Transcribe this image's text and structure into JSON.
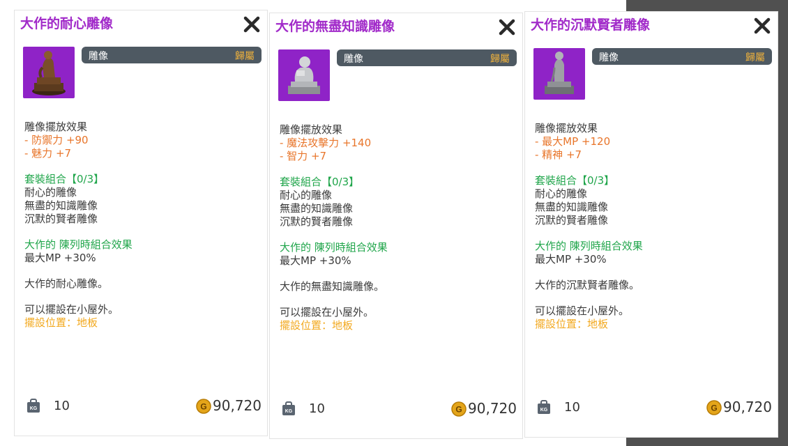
{
  "panels": [
    {
      "title": "大作的耐心雕像",
      "type_label": "雕像",
      "bind_label": "歸屬",
      "effect_heading": "雕像擺放效果",
      "stats": [
        "- 防禦力 +90",
        "- 魅力 +7"
      ],
      "set_heading": "套裝組合【0/3】",
      "set_items": [
        "耐心的雕像",
        "無盡的知識雕像",
        "沉默的賢者雕像"
      ],
      "combo_heading": "大作的 陳列時組合效果",
      "combo_effect": "最大MP +30%",
      "description": "大作的耐心雕像。",
      "placement_note": "可以擺設在小屋外。",
      "placement_location": "擺設位置：地板",
      "weight": "10",
      "price": "90,720",
      "thumb_bg": "#8f23c7"
    },
    {
      "title": "大作的無盡知識雕像",
      "type_label": "雕像",
      "bind_label": "歸屬",
      "effect_heading": "雕像擺放效果",
      "stats": [
        "- 魔法攻擊力 +140",
        "- 智力 +7"
      ],
      "set_heading": "套裝組合【0/3】",
      "set_items": [
        "耐心的雕像",
        "無盡的知識雕像",
        "沉默的賢者雕像"
      ],
      "combo_heading": "大作的 陳列時組合效果",
      "combo_effect": "最大MP +30%",
      "description": "大作的無盡知識雕像。",
      "placement_note": "可以擺設在小屋外。",
      "placement_location": "擺設位置：地板",
      "weight": "10",
      "price": "90,720",
      "thumb_bg": "#8f23c7"
    },
    {
      "title": "大作的沉默賢者雕像",
      "type_label": "雕像",
      "bind_label": "歸屬",
      "effect_heading": "雕像擺放效果",
      "stats": [
        "- 最大MP +120",
        "- 精神 +7"
      ],
      "set_heading": "套裝組合【0/3】",
      "set_items": [
        "耐心的雕像",
        "無盡的知識雕像",
        "沉默的賢者雕像"
      ],
      "combo_heading": "大作的 陳列時組合效果",
      "combo_effect": "最大MP +30%",
      "description": "大作的沉默賢者雕像。",
      "placement_note": "可以擺設在小屋外。",
      "placement_location": "擺設位置：地板",
      "weight": "10",
      "price": "90,720",
      "thumb_bg": "#8f23c7"
    }
  ],
  "icons": {
    "close": "close-icon",
    "weight": "kg-weight-icon",
    "currency": "gold-coin-icon"
  },
  "colors": {
    "title": "#a12ac9",
    "stat": "#e8752a",
    "set": "#1fa54a",
    "placement": "#f2a81d",
    "type_bar": "#4e5962",
    "bind": "#f0b23c"
  }
}
